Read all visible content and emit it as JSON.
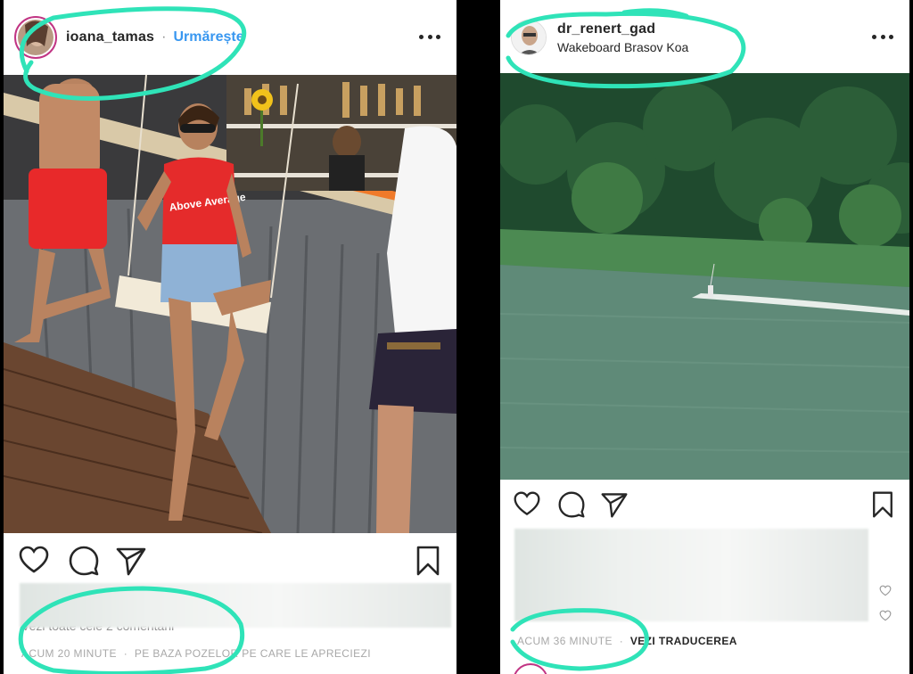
{
  "left_post": {
    "username": "ioana_tamas",
    "separator": "·",
    "follow_label": "Urmărește",
    "timestamp": "ACUM 20 MINUTE",
    "meta_separator": "·",
    "meta_note": "PE BAZA POZELOR PE CARE LE APRECIEZI",
    "partial_comment": "Vezi toate cele 2 comentarii",
    "photo_text": "Above Average"
  },
  "right_post": {
    "username": "dr_renert_gad",
    "location": "Wakeboard Brasov Koa",
    "timestamp": "ACUM 36 MINUTE",
    "meta_separator": "·",
    "translate_label": "VEZI TRADUCEREA"
  },
  "icons": [
    "heart-icon",
    "comment-icon",
    "share-icon",
    "bookmark-icon",
    "more-icon"
  ],
  "colors": {
    "highlight": "#2fe3b8",
    "follow": "#3897f0",
    "meta": "#a8a8a8",
    "text": "#262626"
  }
}
